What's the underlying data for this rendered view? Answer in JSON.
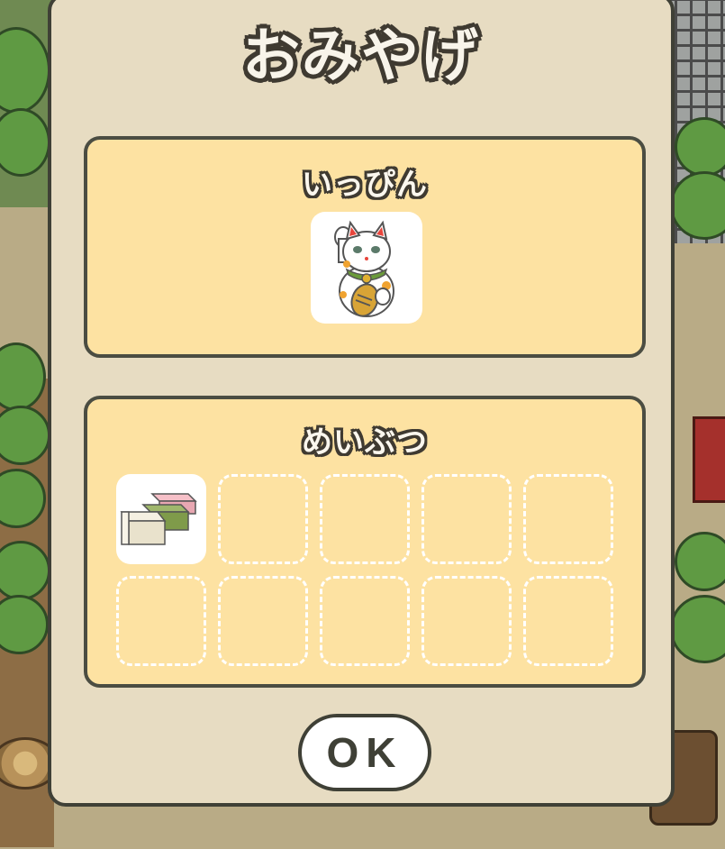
{
  "dialog": {
    "title": "おみやげ",
    "ok_label": "OK"
  },
  "sections": [
    {
      "label": "いっぴん",
      "items": [
        {
          "icon": "maneki-neko-icon",
          "name": "maneki-neko"
        }
      ]
    },
    {
      "label": "めいぶつ",
      "items": [
        {
          "icon": "yokan-sweets-icon",
          "name": "yokan"
        }
      ],
      "total_slots": 10,
      "empty_slots": 9
    }
  ],
  "colors": {
    "dialog_bg": "#e7dcc2",
    "section_bg": "#fde2a2",
    "outline": "#3f4036"
  }
}
